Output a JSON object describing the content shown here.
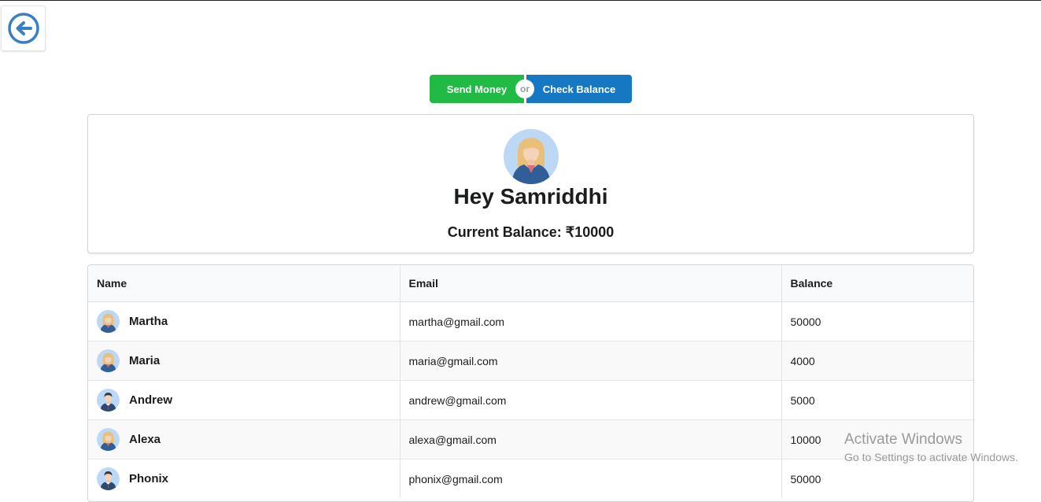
{
  "nav": {
    "back_icon": "arrow-left-circle-icon"
  },
  "actions": {
    "send_money": "Send Money",
    "separator": "or",
    "check_balance": "Check Balance",
    "send_color": "#21ba45",
    "check_color": "#1678c2"
  },
  "profile": {
    "greeting": "Hey Samriddhi",
    "balance_text": "Current Balance: ₹10000",
    "avatar_icon": "female-avatar-icon"
  },
  "table": {
    "headers": [
      "Name",
      "Email",
      "Balance"
    ],
    "rows": [
      {
        "name": "Martha",
        "email": "martha@gmail.com",
        "balance": "50000",
        "avatar": "female"
      },
      {
        "name": "Maria",
        "email": "maria@gmail.com",
        "balance": "4000",
        "avatar": "female"
      },
      {
        "name": "Andrew",
        "email": "andrew@gmail.com",
        "balance": "5000",
        "avatar": "male"
      },
      {
        "name": "Alexa",
        "email": "alexa@gmail.com",
        "balance": "10000",
        "avatar": "female"
      },
      {
        "name": "Phonix",
        "email": "phonix@gmail.com",
        "balance": "50000",
        "avatar": "male"
      }
    ]
  },
  "watermark": {
    "title": "Activate Windows",
    "subtitle": "Go to Settings to activate Windows."
  }
}
